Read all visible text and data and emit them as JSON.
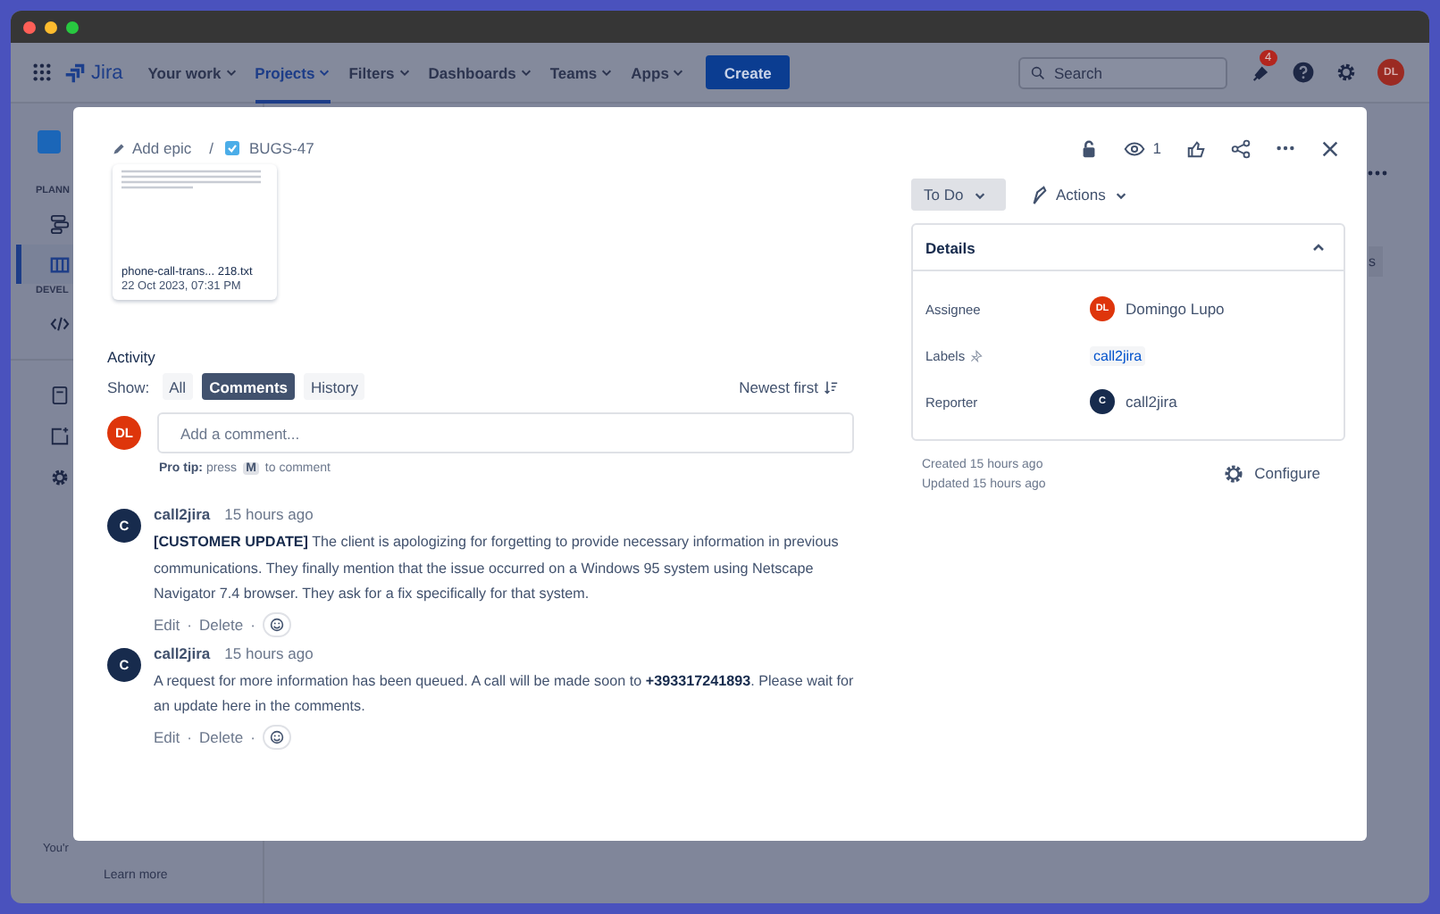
{
  "nav": {
    "product": "Jira",
    "items": [
      {
        "label": "Your work",
        "selected": false
      },
      {
        "label": "Projects",
        "selected": true
      },
      {
        "label": "Filters",
        "selected": false
      },
      {
        "label": "Dashboards",
        "selected": false
      },
      {
        "label": "Teams",
        "selected": false
      },
      {
        "label": "Apps",
        "selected": false
      }
    ],
    "create": "Create",
    "search": {
      "placeholder": "Search"
    },
    "notifications": "4",
    "avatar": "DL"
  },
  "sidebar": {
    "sections": [
      {
        "title": "PLANN",
        "items": [
          {
            "kind": "timeline",
            "selected": false
          },
          {
            "kind": "board",
            "selected": true
          }
        ]
      },
      {
        "title": "DEVEL",
        "items": [
          {
            "kind": "code",
            "selected": false
          }
        ]
      }
    ],
    "tools": [
      {
        "kind": "page"
      },
      {
        "kind": "add"
      },
      {
        "kind": "settings"
      }
    ],
    "footer": "You'r",
    "footer_link": "Learn more"
  },
  "backdrop": {
    "chip": "s"
  },
  "issue": {
    "breadcrumb": {
      "epic": "Add epic",
      "separator": "/",
      "key": "BUGS-47"
    },
    "watchers": "1",
    "attachment": {
      "name": "phone-call-trans... 218.txt",
      "date": "22 Oct 2023, 07:31 PM"
    },
    "activity": {
      "title": "Activity",
      "show_label": "Show:",
      "filters": [
        {
          "label": "All",
          "selected": false
        },
        {
          "label": "Comments",
          "selected": true
        },
        {
          "label": "History",
          "selected": false
        }
      ],
      "sort": "Newest first",
      "comment_box": {
        "avatar": "DL",
        "placeholder": "Add a comment..."
      },
      "pro_tip": "**Pro tip:** press",
      "pro_tip_key": "M",
      "pro_tip_end": "to comment"
    },
    "comments": [
      {
        "avatar": "C",
        "author": "call2jira",
        "time": "15 hours ago",
        "body": "**[CUSTOMER UPDATE]** The client is apologizing for forgetting to provide necessary information in previous communications. They finally mention that the issue occurred on a Windows 95 system using Netscape Navigator 7.4 browser. They ask for a fix specifically for that system.",
        "actions": [
          "Edit",
          "Delete"
        ],
        "separator": "·"
      },
      {
        "avatar": "C",
        "author": "call2jira",
        "time": "15 hours ago",
        "body": "A request for more information has been queued. A call will be made soon to **+393317241893**. Please wait for an update here in the comments.",
        "actions": [
          "Edit",
          "Delete"
        ],
        "separator": "·"
      }
    ],
    "status": "To Do",
    "actions": "Actions",
    "details": {
      "title": "Details",
      "expanded": true,
      "fields": [
        {
          "label": "Assignee",
          "kind": "user",
          "avatar": "DL",
          "color": "#de350b",
          "value": "Domingo Lupo"
        },
        {
          "label": "Labels",
          "kind": "label",
          "value": "call2jira"
        },
        {
          "label": "Reporter",
          "kind": "user",
          "avatar": "C",
          "color": "#172b4d",
          "value": "call2jira"
        }
      ]
    },
    "created": "Created 15 hours ago",
    "updated": "Updated 15 hours ago",
    "configure": "Configure"
  }
}
